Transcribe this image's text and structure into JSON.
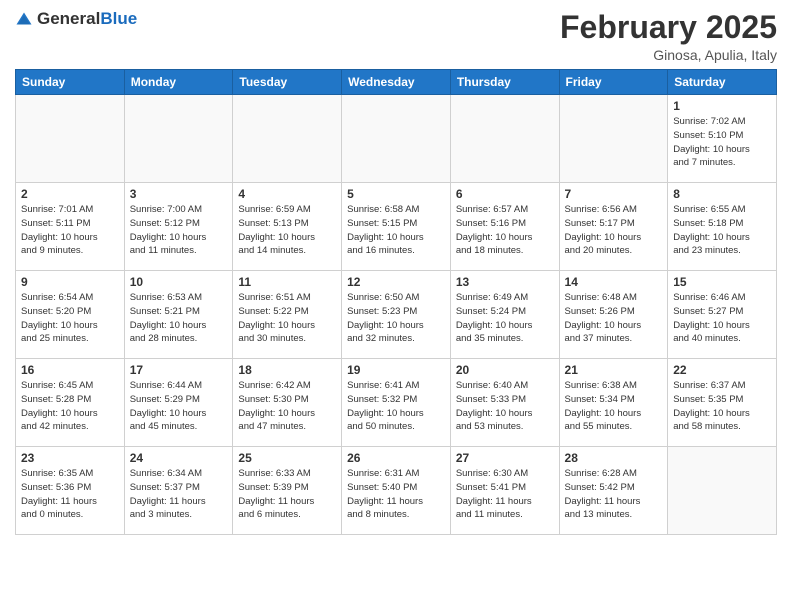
{
  "header": {
    "logo_general": "General",
    "logo_blue": "Blue",
    "title": "February 2025",
    "location": "Ginosa, Apulia, Italy"
  },
  "weekdays": [
    "Sunday",
    "Monday",
    "Tuesday",
    "Wednesday",
    "Thursday",
    "Friday",
    "Saturday"
  ],
  "weeks": [
    [
      {
        "day": "",
        "info": ""
      },
      {
        "day": "",
        "info": ""
      },
      {
        "day": "",
        "info": ""
      },
      {
        "day": "",
        "info": ""
      },
      {
        "day": "",
        "info": ""
      },
      {
        "day": "",
        "info": ""
      },
      {
        "day": "1",
        "info": "Sunrise: 7:02 AM\nSunset: 5:10 PM\nDaylight: 10 hours\nand 7 minutes."
      }
    ],
    [
      {
        "day": "2",
        "info": "Sunrise: 7:01 AM\nSunset: 5:11 PM\nDaylight: 10 hours\nand 9 minutes."
      },
      {
        "day": "3",
        "info": "Sunrise: 7:00 AM\nSunset: 5:12 PM\nDaylight: 10 hours\nand 11 minutes."
      },
      {
        "day": "4",
        "info": "Sunrise: 6:59 AM\nSunset: 5:13 PM\nDaylight: 10 hours\nand 14 minutes."
      },
      {
        "day": "5",
        "info": "Sunrise: 6:58 AM\nSunset: 5:15 PM\nDaylight: 10 hours\nand 16 minutes."
      },
      {
        "day": "6",
        "info": "Sunrise: 6:57 AM\nSunset: 5:16 PM\nDaylight: 10 hours\nand 18 minutes."
      },
      {
        "day": "7",
        "info": "Sunrise: 6:56 AM\nSunset: 5:17 PM\nDaylight: 10 hours\nand 20 minutes."
      },
      {
        "day": "8",
        "info": "Sunrise: 6:55 AM\nSunset: 5:18 PM\nDaylight: 10 hours\nand 23 minutes."
      }
    ],
    [
      {
        "day": "9",
        "info": "Sunrise: 6:54 AM\nSunset: 5:20 PM\nDaylight: 10 hours\nand 25 minutes."
      },
      {
        "day": "10",
        "info": "Sunrise: 6:53 AM\nSunset: 5:21 PM\nDaylight: 10 hours\nand 28 minutes."
      },
      {
        "day": "11",
        "info": "Sunrise: 6:51 AM\nSunset: 5:22 PM\nDaylight: 10 hours\nand 30 minutes."
      },
      {
        "day": "12",
        "info": "Sunrise: 6:50 AM\nSunset: 5:23 PM\nDaylight: 10 hours\nand 32 minutes."
      },
      {
        "day": "13",
        "info": "Sunrise: 6:49 AM\nSunset: 5:24 PM\nDaylight: 10 hours\nand 35 minutes."
      },
      {
        "day": "14",
        "info": "Sunrise: 6:48 AM\nSunset: 5:26 PM\nDaylight: 10 hours\nand 37 minutes."
      },
      {
        "day": "15",
        "info": "Sunrise: 6:46 AM\nSunset: 5:27 PM\nDaylight: 10 hours\nand 40 minutes."
      }
    ],
    [
      {
        "day": "16",
        "info": "Sunrise: 6:45 AM\nSunset: 5:28 PM\nDaylight: 10 hours\nand 42 minutes."
      },
      {
        "day": "17",
        "info": "Sunrise: 6:44 AM\nSunset: 5:29 PM\nDaylight: 10 hours\nand 45 minutes."
      },
      {
        "day": "18",
        "info": "Sunrise: 6:42 AM\nSunset: 5:30 PM\nDaylight: 10 hours\nand 47 minutes."
      },
      {
        "day": "19",
        "info": "Sunrise: 6:41 AM\nSunset: 5:32 PM\nDaylight: 10 hours\nand 50 minutes."
      },
      {
        "day": "20",
        "info": "Sunrise: 6:40 AM\nSunset: 5:33 PM\nDaylight: 10 hours\nand 53 minutes."
      },
      {
        "day": "21",
        "info": "Sunrise: 6:38 AM\nSunset: 5:34 PM\nDaylight: 10 hours\nand 55 minutes."
      },
      {
        "day": "22",
        "info": "Sunrise: 6:37 AM\nSunset: 5:35 PM\nDaylight: 10 hours\nand 58 minutes."
      }
    ],
    [
      {
        "day": "23",
        "info": "Sunrise: 6:35 AM\nSunset: 5:36 PM\nDaylight: 11 hours\nand 0 minutes."
      },
      {
        "day": "24",
        "info": "Sunrise: 6:34 AM\nSunset: 5:37 PM\nDaylight: 11 hours\nand 3 minutes."
      },
      {
        "day": "25",
        "info": "Sunrise: 6:33 AM\nSunset: 5:39 PM\nDaylight: 11 hours\nand 6 minutes."
      },
      {
        "day": "26",
        "info": "Sunrise: 6:31 AM\nSunset: 5:40 PM\nDaylight: 11 hours\nand 8 minutes."
      },
      {
        "day": "27",
        "info": "Sunrise: 6:30 AM\nSunset: 5:41 PM\nDaylight: 11 hours\nand 11 minutes."
      },
      {
        "day": "28",
        "info": "Sunrise: 6:28 AM\nSunset: 5:42 PM\nDaylight: 11 hours\nand 13 minutes."
      },
      {
        "day": "",
        "info": ""
      }
    ]
  ]
}
